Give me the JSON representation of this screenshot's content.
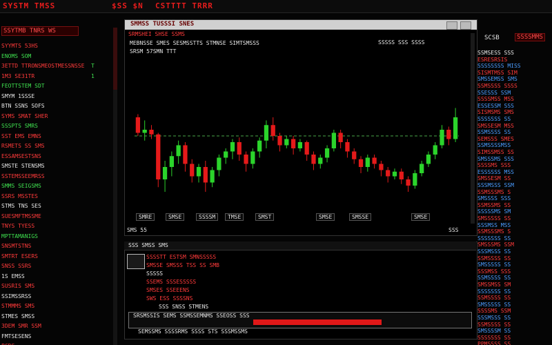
{
  "topbar": {
    "title_left": "SYSTM TMSS",
    "title_mid": "$SS $N",
    "title_right": "CSTTTT TRRR"
  },
  "left_panel": {
    "header": "SSYTMB  TNRS  WS",
    "rows": [
      {
        "a": "SYYMTS 53HS",
        "b": "",
        "c": "red"
      },
      {
        "a": "ENOMS SOM",
        "b": "",
        "c": "green"
      },
      {
        "a": "3ETTD TTRONSMEOSTMESSNSSE",
        "b": "T",
        "c": "red"
      },
      {
        "a": "1M3 SE31TR",
        "b": "1",
        "c": "red"
      },
      {
        "a": "FEOTTSTEM SDT",
        "b": "",
        "c": "green"
      },
      {
        "a": "SMYM 1SSSE",
        "b": "",
        "c": "white"
      },
      {
        "a": "BTN SSNS SOFS",
        "b": "",
        "c": "white"
      },
      {
        "a": "SYMS SMAT SHER",
        "b": "",
        "c": "red"
      },
      {
        "a": "SSSPTS SMRS",
        "b": "",
        "c": "green"
      },
      {
        "a": "SST EMS EMNS",
        "b": "",
        "c": "red"
      },
      {
        "a": "RSMETS SS SMS",
        "b": "",
        "c": "red"
      },
      {
        "a": "ESSAMSESTSNS",
        "b": "",
        "c": "red"
      },
      {
        "a": "SMSTE STENSMS",
        "b": "",
        "c": "white"
      },
      {
        "a": "SSTEMSSEEMRSS",
        "b": "",
        "c": "red"
      },
      {
        "a": "SMMS SEIGSMS",
        "b": "",
        "c": "green"
      },
      {
        "a": "SSRS MSSTES",
        "b": "",
        "c": "red"
      },
      {
        "a": "STMS TNS SES",
        "b": "",
        "c": "white"
      },
      {
        "a": "SUESMFTMSSME",
        "b": "",
        "c": "red"
      },
      {
        "a": "TNYS TYESS",
        "b": "",
        "c": "red"
      },
      {
        "a": "MPTTAMANIGS",
        "b": "",
        "c": "green"
      },
      {
        "a": "SNSMTSTNS",
        "b": "",
        "c": "red"
      },
      {
        "a": "SMTRT ESERS",
        "b": "",
        "c": "red"
      },
      {
        "a": "SNSS SSRS",
        "b": "",
        "c": "red"
      },
      {
        "a": "1S EMSS",
        "b": "",
        "c": "white"
      },
      {
        "a": "SUSRIS SMS",
        "b": "",
        "c": "red"
      },
      {
        "a": "SSIMSSRSS",
        "b": "",
        "c": "white"
      },
      {
        "a": "STMMMS SMS",
        "b": "",
        "c": "red"
      },
      {
        "a": "STMES SMSS",
        "b": "",
        "c": "white"
      },
      {
        "a": "3DEM SMR SSM",
        "b": "",
        "c": "red"
      },
      {
        "a": "FMTSESENS",
        "b": "",
        "c": "white"
      },
      {
        "a": "PCDS",
        "b": "",
        "c": "red"
      }
    ]
  },
  "chart_window": {
    "title": "SMMSS TUSSSI SNES",
    "header_line": "SRMSHEI  SHSE  SSMS",
    "toolbar": "MEBNSSE  SMES  SESMSSTTS  STMNSE  SIMTSMSSS",
    "toolbar_right": "SSSSS  SSS  SSSS",
    "sub": "SRSM 57SMN TTT",
    "footer_left": "SMS 55",
    "footer_right": "SSS",
    "accent_up": "#2bd42b",
    "accent_down": "#e51a1a"
  },
  "chart_data": {
    "type": "candlestick",
    "x_ticks": [
      "SMRE",
      "SMSE",
      "SSSSM",
      "TMSE",
      "SMST",
      "SMSE",
      "SMSSE",
      "SMSE"
    ],
    "reference_line": 48,
    "ylim": [
      0,
      100
    ],
    "candles": [
      [
        60,
        50,
        48,
        62
      ],
      [
        50,
        52,
        45,
        58
      ],
      [
        52,
        49,
        46,
        55
      ],
      [
        49,
        20,
        15,
        50
      ],
      [
        20,
        28,
        12,
        32
      ],
      [
        28,
        35,
        22,
        38
      ],
      [
        35,
        42,
        30,
        45
      ],
      [
        42,
        30,
        25,
        44
      ],
      [
        30,
        22,
        18,
        33
      ],
      [
        22,
        28,
        18,
        30
      ],
      [
        28,
        18,
        12,
        32
      ],
      [
        18,
        26,
        15,
        28
      ],
      [
        26,
        34,
        22,
        36
      ],
      [
        34,
        38,
        30,
        40
      ],
      [
        38,
        44,
        33,
        46
      ],
      [
        44,
        36,
        32,
        47
      ],
      [
        36,
        30,
        25,
        38
      ],
      [
        30,
        38,
        27,
        40
      ],
      [
        38,
        45,
        34,
        47
      ],
      [
        45,
        55,
        40,
        58
      ],
      [
        55,
        48,
        45,
        60
      ],
      [
        48,
        42,
        38,
        50
      ],
      [
        42,
        46,
        40,
        48
      ],
      [
        46,
        40,
        36,
        48
      ],
      [
        40,
        44,
        38,
        46
      ],
      [
        44,
        36,
        32,
        45
      ],
      [
        36,
        30,
        26,
        38
      ],
      [
        30,
        34,
        27,
        36
      ],
      [
        34,
        40,
        31,
        42
      ],
      [
        40,
        50,
        38,
        52
      ],
      [
        50,
        44,
        40,
        52
      ],
      [
        44,
        38,
        34,
        46
      ],
      [
        38,
        33,
        30,
        40
      ],
      [
        33,
        28,
        24,
        35
      ],
      [
        28,
        34,
        25,
        36
      ],
      [
        34,
        30,
        27,
        36
      ],
      [
        30,
        26,
        22,
        32
      ],
      [
        26,
        22,
        18,
        28
      ],
      [
        22,
        25,
        20,
        27
      ],
      [
        25,
        20,
        17,
        27
      ],
      [
        20,
        16,
        12,
        22
      ],
      [
        16,
        24,
        14,
        26
      ],
      [
        24,
        30,
        22,
        32
      ],
      [
        30,
        36,
        28,
        38
      ],
      [
        36,
        42,
        33,
        44
      ],
      [
        42,
        52,
        40,
        55
      ],
      [
        52,
        46,
        42,
        54
      ],
      [
        46,
        60,
        44,
        66
      ]
    ]
  },
  "bottom_window": {
    "title": "SSS  SMSS  SMS",
    "rows": [
      {
        "text": "SSSSTT  ESTSM SMNSSSSS",
        "c": "red"
      },
      {
        "text": "SMSSE SMSSS TSS SS SMB",
        "c": "red"
      },
      {
        "text": "SSSSS",
        "c": "white"
      },
      {
        "text": "SSEMS  SSSESSSSS",
        "c": "red"
      },
      {
        "text": "SMSES  SSEEENS",
        "c": "red"
      },
      {
        "text": "SWS  ESS  SSSSNS",
        "c": "red"
      },
      {
        "text": "SSS  SNSS  STMENS",
        "c": "white"
      }
    ],
    "order_bar_label": "SRSMSSIS  SEMS  SSMSSEMNMS  SSEOSS  SSS",
    "order_bar_sub": "SEMSSMS  SSSSRMS  SSSS  STS  SSSMSSMS",
    "order_bar_fill": 0.62
  },
  "right_panel": {
    "header": "SCSB",
    "header2": "SSSSMMS",
    "rows": [
      {
        "t": "SSMSESS  SSS",
        "c": "white"
      },
      {
        "t": "ESRESRSIS",
        "c": "red"
      },
      {
        "t": "SSSSSSSS  MISS",
        "c": "blue"
      },
      {
        "t": "SISMTMSS  SIM",
        "c": "red"
      },
      {
        "t": "SMSSEMSS  SMS",
        "c": "blue"
      },
      {
        "t": "SSMSSSS  SSSS",
        "c": "red"
      },
      {
        "t": "SSESSS  SSM",
        "c": "blue"
      },
      {
        "t": "SSSSMSS  MSS",
        "c": "red"
      },
      {
        "t": "ESSESSM  SSS",
        "c": "blue"
      },
      {
        "t": "SISMSMS  SMS",
        "c": "red"
      },
      {
        "t": "SSSSSSS  SS",
        "c": "blue"
      },
      {
        "t": "SMSSESM  MSS",
        "c": "red"
      },
      {
        "t": "SSMSSSS  SS",
        "c": "blue"
      },
      {
        "t": "SEMSSS  SMES",
        "c": "red"
      },
      {
        "t": "SSMSSSSMSS",
        "c": "blue"
      },
      {
        "t": "SIMSSMSS  SS",
        "c": "red"
      },
      {
        "t": "SMSSSMS  SSS",
        "c": "blue"
      },
      {
        "t": "SSSSMS  SSS",
        "c": "red"
      },
      {
        "t": "ESSSSSS  MSS",
        "c": "blue"
      },
      {
        "t": "SMSSESM  SS",
        "c": "red"
      },
      {
        "t": "SSSMSSS  SSM",
        "c": "blue"
      },
      {
        "t": "SSMSSSMS  S",
        "c": "red"
      },
      {
        "t": "SMSSSS  SSS",
        "c": "blue"
      },
      {
        "t": "SSMSSMS  SS",
        "c": "red"
      },
      {
        "t": "SSSSSMS  SM",
        "c": "blue"
      },
      {
        "t": "SMSSSSS  SS",
        "c": "red"
      },
      {
        "t": "SSSMSS  MSS",
        "c": "blue"
      },
      {
        "t": "SSMSSSMS  S",
        "c": "red"
      },
      {
        "t": "SSSSSSS  SS",
        "c": "blue"
      },
      {
        "t": "SMSSSMS  SSM",
        "c": "red"
      },
      {
        "t": "SSSMSSS  SS",
        "c": "blue"
      },
      {
        "t": "SSMSSSS  SS",
        "c": "red"
      },
      {
        "t": "SMSSSSS  SS",
        "c": "blue"
      },
      {
        "t": "SSSMSS  SSS",
        "c": "red"
      },
      {
        "t": "SSMSSSS  SS",
        "c": "blue"
      },
      {
        "t": "SMSSMSS  SM",
        "c": "red"
      },
      {
        "t": "SSSSSSS  SS",
        "c": "blue"
      },
      {
        "t": "SSMSSSS  SS",
        "c": "red"
      },
      {
        "t": "SMSSSSS  SS",
        "c": "blue"
      },
      {
        "t": "SSSSMS  SSM",
        "c": "red"
      },
      {
        "t": "SSSMSSS  SS",
        "c": "blue"
      },
      {
        "t": "SSMSSSS  SS",
        "c": "red"
      },
      {
        "t": "SMSSSSM  SS",
        "c": "blue"
      },
      {
        "t": "SSSSSSS  SS",
        "c": "red"
      },
      {
        "t": "PPMSSSS  SS",
        "c": "red"
      }
    ]
  }
}
